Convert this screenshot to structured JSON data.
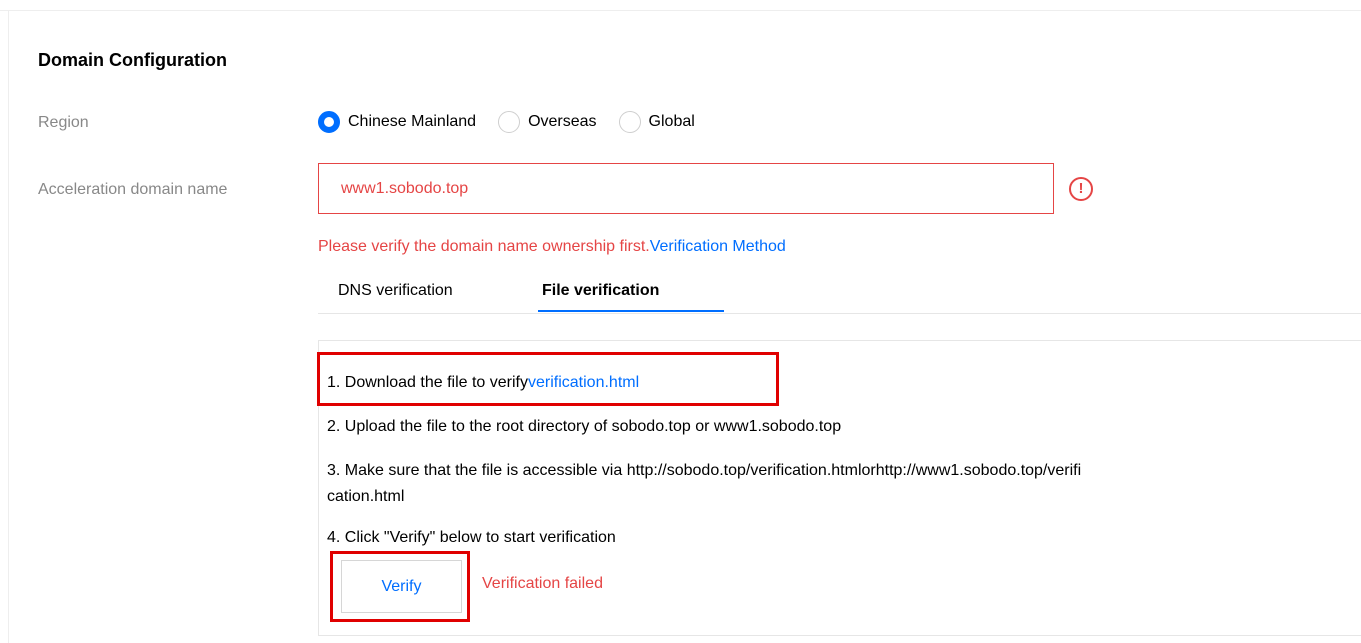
{
  "section": {
    "title": "Domain Configuration"
  },
  "region": {
    "label": "Region",
    "options": [
      {
        "label": "Chinese Mainland",
        "checked": true
      },
      {
        "label": "Overseas",
        "checked": false
      },
      {
        "label": "Global",
        "checked": false
      }
    ]
  },
  "domain": {
    "label": "Acceleration domain name",
    "value": "www1.sobodo.top",
    "error_icon": "!",
    "error_message": "Please verify the domain name ownership first.",
    "verification_method_link": "Verification Method"
  },
  "tabs": {
    "dns": "DNS verification",
    "file": "File verification",
    "active": "file"
  },
  "steps": {
    "step1_text": "1. Download the file to verify",
    "step1_link": "verification.html",
    "step2": "2. Upload the file to the root directory of sobodo.top or www1.sobodo.top",
    "step3_line1": "3. Make sure that the file is accessible via http://sobodo.top/verification.htmlorhttp://www1.sobodo.top/verifi",
    "step3_line2": "cation.html",
    "step4": "4. Click \"Verify\" below to start verification"
  },
  "verify": {
    "button_label": "Verify",
    "status": "Verification failed"
  },
  "colors": {
    "accent": "#006eff",
    "error": "#e54545",
    "highlight": "#e00000"
  }
}
